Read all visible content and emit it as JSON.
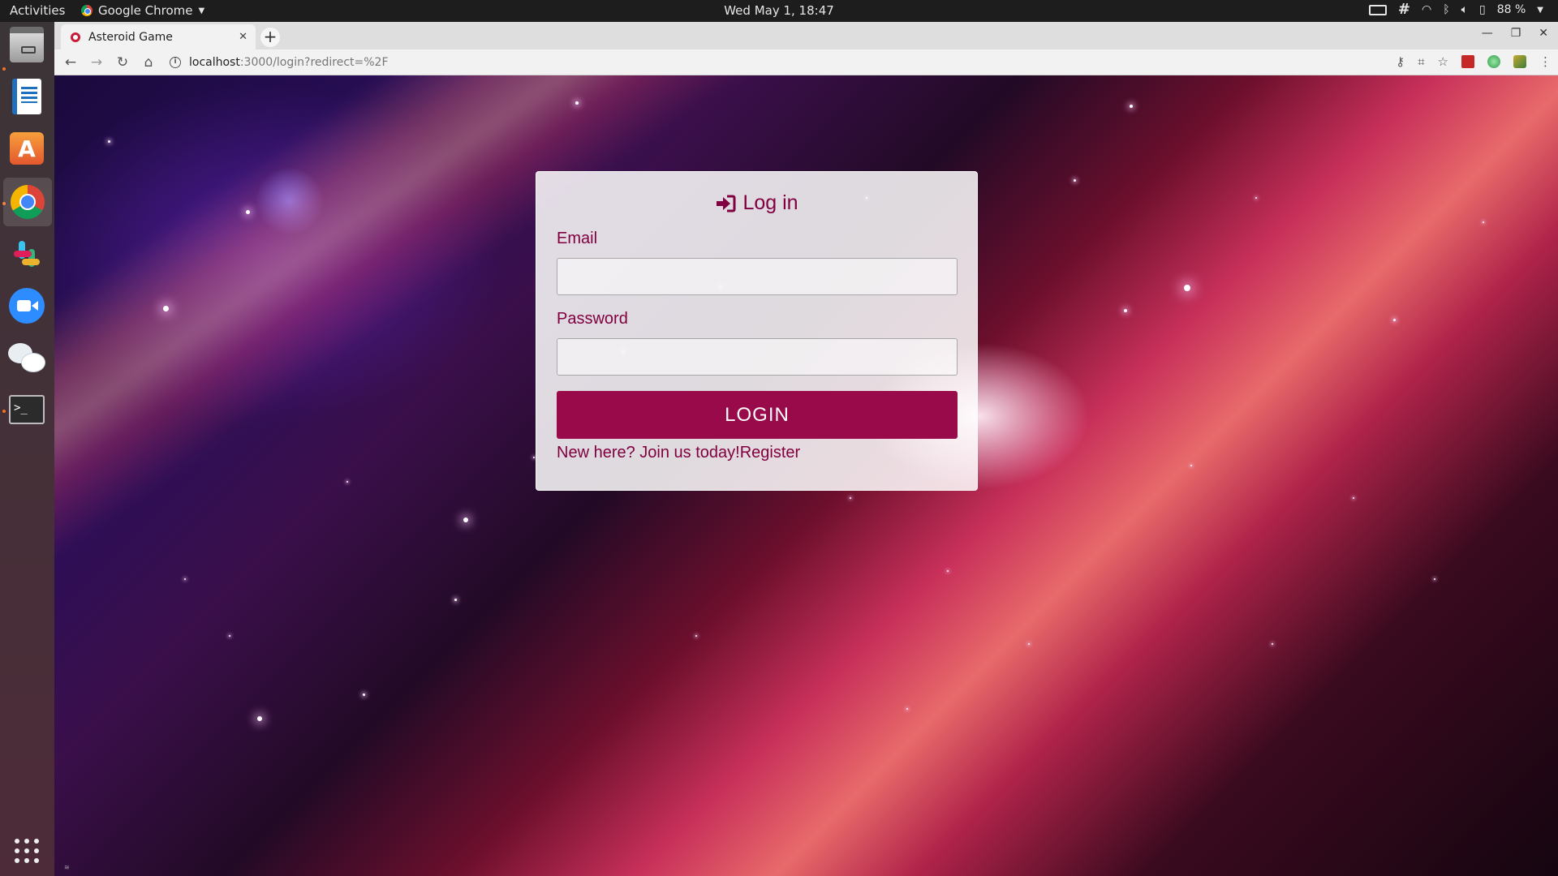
{
  "system": {
    "activities": "Activities",
    "app_name": "Google Chrome",
    "clock": "Wed May  1, 18:47",
    "battery": "88 %"
  },
  "browser": {
    "tab_title": "Asteroid Game",
    "url_host": "localhost",
    "url_path": ":3000/login?redirect=%2F"
  },
  "login": {
    "title": "Log in",
    "email_label": "Email",
    "email_value": "",
    "password_label": "Password",
    "password_value": "",
    "button_label": "LOGIN",
    "register_prompt": "New here? Join us today!",
    "register_link": "Register"
  },
  "colors": {
    "accent": "#980a4a",
    "text_primary": "#800040",
    "card_bg": "rgba(255,255,255,0.85)"
  }
}
